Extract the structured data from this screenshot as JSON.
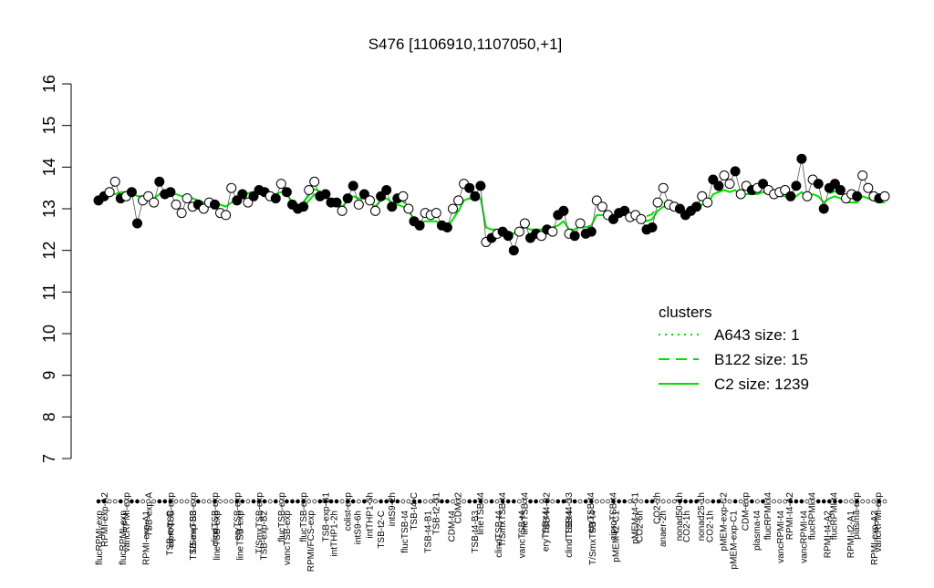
{
  "chart_data": {
    "type": "scatter",
    "title": "S476 [1106910,1107050,+1]",
    "xlabel": "",
    "ylabel": "",
    "ylim": [
      7,
      16
    ],
    "yticks": [
      7,
      8,
      9,
      10,
      11,
      12,
      13,
      14,
      15,
      16
    ],
    "grid": false,
    "legend": {
      "title": "clusters",
      "placement": "right",
      "entries": [
        {
          "label": "A643 size: 1",
          "style": "dotted"
        },
        {
          "label": "B122 size: 15",
          "style": "dashed"
        },
        {
          "label": "C2 size: 1239",
          "style": "solid"
        }
      ]
    },
    "colors": {
      "line": "#00e000",
      "point_fill_a": "#000000",
      "point_fill_b": "#ffffff",
      "axis": "#000000"
    },
    "top_labels": [
      "RPMI-exp-A2",
      "vancRPMI-exp",
      "TSB-exp-A",
      "ciproTSB-exp",
      "T/SmxTSB-exp",
      "clindTSB-exp",
      "eryTSB-exp",
      "T/SmxTSB-exp",
      "flucTSB-exp",
      "flucTSB-exp",
      "TSB-exp-B1",
      "colist-exp",
      "intTHP1-6h",
      "intS9-2h",
      "TSB-t4-C",
      "TSB-t2-B1",
      "CDM-t2",
      "lineTSB-t4",
      "T/SmxTSB-t4",
      "lineTSB-t4",
      "TSB-t4-B2",
      "TSB-t4-B3",
      "eryTSB-t4",
      "ciproTSB-t4",
      "pMEM-t4-C1",
      "CO2-2h",
      "nonad50-1h",
      "nonad25-1h",
      "pMEM-exp-C2",
      "CDM-exp",
      "flucRPMI-t4",
      "RPMI-t4-A2",
      "flucRPMI-t4",
      "flucRPMI-t4",
      "plasma-exp",
      "vancRPMI-exp"
    ],
    "bottom_labels": [
      "flucRPMI-exp",
      "flucRPMI-exp",
      "RPMI-exp-A1",
      "TSB-exp-C",
      "TSB-exp-B3",
      "lineTSB-exp",
      "lineTSB-exp",
      "TSB-exp-B2",
      "vancTSB-exp",
      "RPMI/FCS-exp",
      "intTHP1-2h",
      "intS9-6h",
      "TSB-t2-C",
      "flucTSB-t4",
      "TSB-t4-B1",
      "CDM-t4",
      "TSB-t4-B3",
      "clindTSB-t4",
      "vancTSB-t4",
      "eryTSB-t4",
      "clindTSB-t4",
      "T/SmxTSB-t4",
      "pMEM-t2-C1",
      "CO2-6h",
      "anaer-2h",
      "CO2-1h",
      "CO2-1h",
      "pMEM-exp-C1",
      "plasma-t4",
      "vancRPMI-t4",
      "vancRPMI-t4",
      "RPMI-t4-A2",
      "RPMI-t2-A1",
      "RPMI-exp-A2"
    ],
    "points": [
      {
        "x": 1,
        "y": 13.2,
        "f": 1
      },
      {
        "x": 2,
        "y": 13.3,
        "f": 1
      },
      {
        "x": 3,
        "y": 13.4,
        "f": 0
      },
      {
        "x": 4,
        "y": 13.65,
        "f": 0
      },
      {
        "x": 5,
        "y": 13.25,
        "f": 1
      },
      {
        "x": 6,
        "y": 13.3,
        "f": 0
      },
      {
        "x": 7,
        "y": 13.4,
        "f": 1
      },
      {
        "x": 8,
        "y": 12.65,
        "f": 1
      },
      {
        "x": 9,
        "y": 13.2,
        "f": 0
      },
      {
        "x": 10,
        "y": 13.3,
        "f": 0
      },
      {
        "x": 11,
        "y": 13.15,
        "f": 0
      },
      {
        "x": 12,
        "y": 13.65,
        "f": 1
      },
      {
        "x": 13,
        "y": 13.35,
        "f": 1
      },
      {
        "x": 14,
        "y": 13.4,
        "f": 1
      },
      {
        "x": 15,
        "y": 13.1,
        "f": 0
      },
      {
        "x": 16,
        "y": 12.9,
        "f": 0
      },
      {
        "x": 17,
        "y": 13.25,
        "f": 0
      },
      {
        "x": 18,
        "y": 13.05,
        "f": 0
      },
      {
        "x": 19,
        "y": 13.1,
        "f": 1
      },
      {
        "x": 20,
        "y": 13.0,
        "f": 0
      },
      {
        "x": 21,
        "y": 13.15,
        "f": 0
      },
      {
        "x": 22,
        "y": 13.1,
        "f": 1
      },
      {
        "x": 23,
        "y": 12.9,
        "f": 0
      },
      {
        "x": 24,
        "y": 12.85,
        "f": 0
      },
      {
        "x": 25,
        "y": 13.5,
        "f": 0
      },
      {
        "x": 26,
        "y": 13.2,
        "f": 1
      },
      {
        "x": 27,
        "y": 13.35,
        "f": 1
      },
      {
        "x": 28,
        "y": 13.15,
        "f": 0
      },
      {
        "x": 29,
        "y": 13.3,
        "f": 1
      },
      {
        "x": 30,
        "y": 13.45,
        "f": 1
      },
      {
        "x": 31,
        "y": 13.4,
        "f": 1
      },
      {
        "x": 32,
        "y": 13.3,
        "f": 0
      },
      {
        "x": 33,
        "y": 13.25,
        "f": 1
      },
      {
        "x": 34,
        "y": 13.6,
        "f": 0
      },
      {
        "x": 35,
        "y": 13.4,
        "f": 1
      },
      {
        "x": 36,
        "y": 13.1,
        "f": 1
      },
      {
        "x": 37,
        "y": 13.0,
        "f": 1
      },
      {
        "x": 38,
        "y": 13.05,
        "f": 1
      },
      {
        "x": 39,
        "y": 13.45,
        "f": 0
      },
      {
        "x": 40,
        "y": 13.65,
        "f": 0
      },
      {
        "x": 41,
        "y": 13.3,
        "f": 1
      },
      {
        "x": 42,
        "y": 13.35,
        "f": 1
      },
      {
        "x": 43,
        "y": 13.15,
        "f": 1
      },
      {
        "x": 44,
        "y": 13.15,
        "f": 1
      },
      {
        "x": 45,
        "y": 12.95,
        "f": 0
      },
      {
        "x": 46,
        "y": 13.25,
        "f": 1
      },
      {
        "x": 47,
        "y": 13.55,
        "f": 1
      },
      {
        "x": 48,
        "y": 13.1,
        "f": 0
      },
      {
        "x": 49,
        "y": 13.35,
        "f": 1
      },
      {
        "x": 50,
        "y": 13.2,
        "f": 0
      },
      {
        "x": 51,
        "y": 12.95,
        "f": 0
      },
      {
        "x": 52,
        "y": 13.3,
        "f": 1
      },
      {
        "x": 53,
        "y": 13.45,
        "f": 1
      },
      {
        "x": 54,
        "y": 13.05,
        "f": 1
      },
      {
        "x": 55,
        "y": 13.25,
        "f": 1
      },
      {
        "x": 56,
        "y": 13.3,
        "f": 0
      },
      {
        "x": 57,
        "y": 13.0,
        "f": 0
      },
      {
        "x": 58,
        "y": 12.7,
        "f": 1
      },
      {
        "x": 59,
        "y": 12.6,
        "f": 1
      },
      {
        "x": 60,
        "y": 12.9,
        "f": 0
      },
      {
        "x": 61,
        "y": 12.85,
        "f": 0
      },
      {
        "x": 62,
        "y": 12.9,
        "f": 0
      },
      {
        "x": 63,
        "y": 12.6,
        "f": 1
      },
      {
        "x": 64,
        "y": 12.55,
        "f": 1
      },
      {
        "x": 65,
        "y": 13.0,
        "f": 0
      },
      {
        "x": 66,
        "y": 13.2,
        "f": 0
      },
      {
        "x": 67,
        "y": 13.6,
        "f": 0
      },
      {
        "x": 68,
        "y": 13.5,
        "f": 1
      },
      {
        "x": 69,
        "y": 13.3,
        "f": 1
      },
      {
        "x": 70,
        "y": 13.55,
        "f": 1
      },
      {
        "x": 71,
        "y": 12.2,
        "f": 0
      },
      {
        "x": 72,
        "y": 12.3,
        "f": 1
      },
      {
        "x": 73,
        "y": 12.4,
        "f": 0
      },
      {
        "x": 74,
        "y": 12.45,
        "f": 1
      },
      {
        "x": 75,
        "y": 12.35,
        "f": 1
      },
      {
        "x": 76,
        "y": 12.0,
        "f": 1
      },
      {
        "x": 77,
        "y": 12.45,
        "f": 0
      },
      {
        "x": 78,
        "y": 12.65,
        "f": 0
      },
      {
        "x": 79,
        "y": 12.3,
        "f": 1
      },
      {
        "x": 80,
        "y": 12.4,
        "f": 1
      },
      {
        "x": 81,
        "y": 12.35,
        "f": 0
      },
      {
        "x": 82,
        "y": 12.5,
        "f": 1
      },
      {
        "x": 83,
        "y": 12.45,
        "f": 0
      },
      {
        "x": 84,
        "y": 12.85,
        "f": 1
      },
      {
        "x": 85,
        "y": 12.95,
        "f": 1
      },
      {
        "x": 86,
        "y": 12.4,
        "f": 0
      },
      {
        "x": 87,
        "y": 12.35,
        "f": 1
      },
      {
        "x": 88,
        "y": 12.65,
        "f": 0
      },
      {
        "x": 89,
        "y": 12.4,
        "f": 1
      },
      {
        "x": 90,
        "y": 12.45,
        "f": 1
      },
      {
        "x": 91,
        "y": 13.2,
        "f": 0
      },
      {
        "x": 92,
        "y": 13.05,
        "f": 0
      },
      {
        "x": 93,
        "y": 12.85,
        "f": 0
      },
      {
        "x": 94,
        "y": 12.75,
        "f": 1
      },
      {
        "x": 95,
        "y": 12.9,
        "f": 1
      },
      {
        "x": 96,
        "y": 12.95,
        "f": 1
      },
      {
        "x": 97,
        "y": 12.8,
        "f": 0
      },
      {
        "x": 98,
        "y": 12.85,
        "f": 0
      },
      {
        "x": 99,
        "y": 12.75,
        "f": 0
      },
      {
        "x": 100,
        "y": 12.5,
        "f": 1
      },
      {
        "x": 101,
        "y": 12.55,
        "f": 1
      },
      {
        "x": 102,
        "y": 13.15,
        "f": 0
      },
      {
        "x": 103,
        "y": 13.5,
        "f": 0
      },
      {
        "x": 104,
        "y": 13.1,
        "f": 0
      },
      {
        "x": 105,
        "y": 13.05,
        "f": 0
      },
      {
        "x": 106,
        "y": 13.0,
        "f": 1
      },
      {
        "x": 107,
        "y": 12.85,
        "f": 1
      },
      {
        "x": 108,
        "y": 12.95,
        "f": 1
      },
      {
        "x": 109,
        "y": 13.05,
        "f": 1
      },
      {
        "x": 110,
        "y": 13.3,
        "f": 0
      },
      {
        "x": 111,
        "y": 13.15,
        "f": 0
      },
      {
        "x": 112,
        "y": 13.7,
        "f": 1
      },
      {
        "x": 113,
        "y": 13.55,
        "f": 1
      },
      {
        "x": 114,
        "y": 13.8,
        "f": 0
      },
      {
        "x": 115,
        "y": 13.6,
        "f": 0
      },
      {
        "x": 116,
        "y": 13.9,
        "f": 1
      },
      {
        "x": 117,
        "y": 13.35,
        "f": 0
      },
      {
        "x": 118,
        "y": 13.55,
        "f": 0
      },
      {
        "x": 119,
        "y": 13.45,
        "f": 1
      },
      {
        "x": 120,
        "y": 13.5,
        "f": 0
      },
      {
        "x": 121,
        "y": 13.6,
        "f": 1
      },
      {
        "x": 122,
        "y": 13.45,
        "f": 0
      },
      {
        "x": 123,
        "y": 13.35,
        "f": 0
      },
      {
        "x": 124,
        "y": 13.4,
        "f": 0
      },
      {
        "x": 125,
        "y": 13.45,
        "f": 0
      },
      {
        "x": 126,
        "y": 13.3,
        "f": 1
      },
      {
        "x": 127,
        "y": 13.55,
        "f": 1
      },
      {
        "x": 128,
        "y": 14.2,
        "f": 1
      },
      {
        "x": 129,
        "y": 13.3,
        "f": 0
      },
      {
        "x": 130,
        "y": 13.7,
        "f": 0
      },
      {
        "x": 131,
        "y": 13.6,
        "f": 1
      },
      {
        "x": 132,
        "y": 13.0,
        "f": 1
      },
      {
        "x": 133,
        "y": 13.5,
        "f": 1
      },
      {
        "x": 134,
        "y": 13.6,
        "f": 1
      },
      {
        "x": 135,
        "y": 13.45,
        "f": 1
      },
      {
        "x": 136,
        "y": 13.25,
        "f": 0
      },
      {
        "x": 137,
        "y": 13.35,
        "f": 0
      },
      {
        "x": 138,
        "y": 13.3,
        "f": 1
      },
      {
        "x": 139,
        "y": 13.8,
        "f": 0
      },
      {
        "x": 140,
        "y": 13.5,
        "f": 0
      },
      {
        "x": 141,
        "y": 13.3,
        "f": 0
      },
      {
        "x": 142,
        "y": 13.25,
        "f": 1
      },
      {
        "x": 143,
        "y": 13.3,
        "f": 0
      }
    ],
    "c2_line": [
      13.25,
      13.3,
      13.35,
      13.35,
      13.4,
      13.4,
      13.4,
      13.3,
      13.3,
      13.3,
      13.25,
      13.35,
      13.4,
      13.4,
      13.35,
      13.3,
      13.3,
      13.25,
      13.2,
      13.15,
      13.15,
      13.15,
      13.1,
      13.05,
      13.15,
      13.2,
      13.25,
      13.25,
      13.3,
      13.35,
      13.35,
      13.35,
      13.35,
      13.4,
      13.35,
      13.15,
      13.05,
      13.05,
      13.2,
      13.35,
      13.3,
      13.3,
      13.2,
      13.15,
      13.05,
      13.2,
      13.3,
      13.25,
      13.25,
      13.15,
      13.05,
      13.2,
      13.25,
      13.15,
      13.1,
      13.05,
      12.95,
      12.75,
      12.65,
      12.7,
      12.7,
      12.7,
      12.6,
      12.55,
      12.75,
      12.95,
      13.2,
      13.25,
      13.2,
      13.25,
      12.55,
      12.5,
      12.5,
      12.5,
      12.45,
      12.4,
      12.5,
      12.55,
      12.5,
      12.5,
      12.5,
      12.55,
      12.55,
      12.6,
      12.7,
      12.5,
      12.5,
      12.6,
      12.55,
      12.6,
      12.85,
      12.85,
      12.85,
      12.8,
      12.85,
      12.85,
      12.8,
      12.8,
      12.8,
      12.7,
      12.75,
      12.95,
      13.05,
      13.05,
      13.0,
      12.95,
      12.9,
      12.95,
      13.0,
      13.1,
      13.1,
      13.35,
      13.4,
      13.45,
      13.4,
      13.45,
      13.3,
      13.35,
      13.35,
      13.35,
      13.4,
      13.35,
      13.3,
      13.3,
      13.3,
      13.25,
      13.3,
      13.4,
      13.25,
      13.35,
      13.3,
      13.15,
      13.25,
      13.3,
      13.25,
      13.15,
      13.15,
      13.15,
      13.3,
      13.25,
      13.2,
      13.15,
      13.15
    ]
  }
}
